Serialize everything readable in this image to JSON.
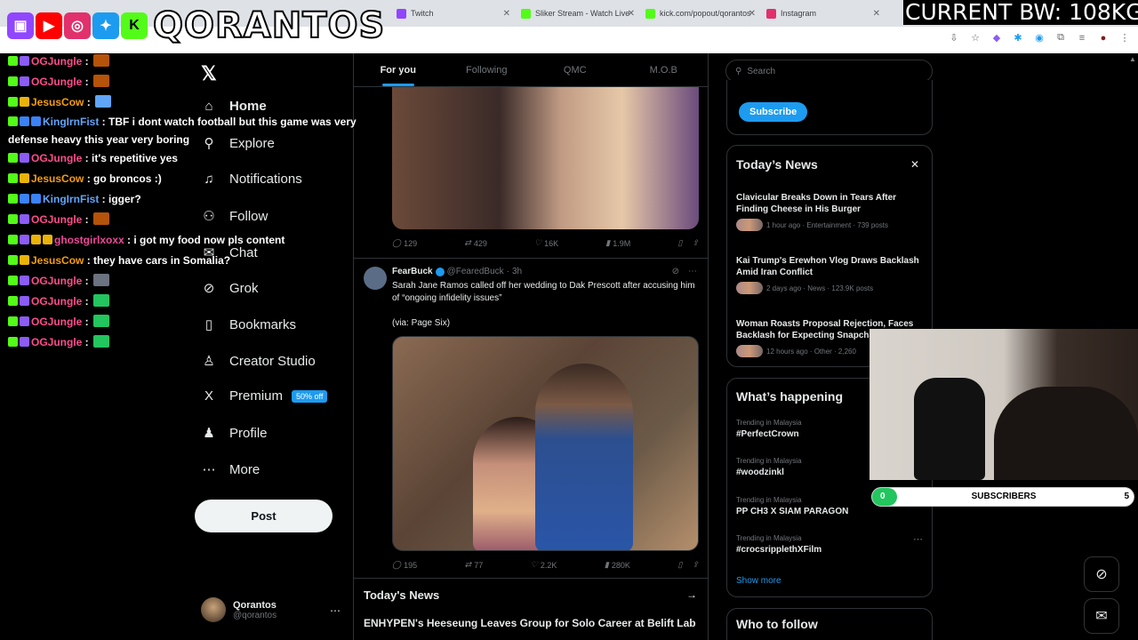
{
  "browser": {
    "tabs": [
      {
        "label": "Twitch",
        "color": "#9146ff"
      },
      {
        "label": "Sliker Stream - Watch Live",
        "color": "#53fc18"
      },
      {
        "label": "kick.com/popout/qorantos",
        "color": "#53fc18"
      },
      {
        "label": "Instagram",
        "color": "#e1306c"
      }
    ]
  },
  "overlay": {
    "logo_text": "QORANTOS",
    "bandwidth": "CURRENT BW: 108KG",
    "social_icons": [
      "twitch-icon",
      "youtube-icon",
      "instagram-icon",
      "twitter-icon",
      "kick-icon"
    ]
  },
  "chat": [
    {
      "user": "OGJungle",
      "color": "#ff4d8d",
      "text": "",
      "badges": [
        "kick",
        "purple"
      ],
      "emote": "#b45309"
    },
    {
      "user": "OGJungle",
      "color": "#ff4d8d",
      "text": "",
      "badges": [
        "kick",
        "purple"
      ],
      "emote": "#b45309"
    },
    {
      "user": "JesusCow",
      "color": "#f59e0b",
      "text": "",
      "badges": [
        "kick",
        "gold"
      ],
      "emote": "#60a5fa"
    },
    {
      "user": "KingIrnFist",
      "color": "#60a5fa",
      "text": "TBF i dont watch football but this game was very defense heavy this year very boring",
      "badges": [
        "kick",
        "blue",
        "blue"
      ],
      "emote": ""
    },
    {
      "user": "OGJungle",
      "color": "#ff4d8d",
      "text": "it's repetitive yes",
      "badges": [
        "kick",
        "purple"
      ],
      "emote": ""
    },
    {
      "user": "JesusCow",
      "color": "#f59e0b",
      "text": "go broncos :)",
      "badges": [
        "kick",
        "gold"
      ],
      "emote": ""
    },
    {
      "user": "KingIrnFist",
      "color": "#60a5fa",
      "text": "igger?",
      "badges": [
        "kick",
        "blue",
        "blue"
      ],
      "emote": ""
    },
    {
      "user": "OGJungle",
      "color": "#ff4d8d",
      "text": "",
      "badges": [
        "kick",
        "purple"
      ],
      "emote": "#b45309"
    },
    {
      "user": "ghostgirlxoxx",
      "color": "#ec4899",
      "text": "i got my food now pls content",
      "badges": [
        "kick",
        "purple",
        "gold",
        "gold"
      ],
      "emote": ""
    },
    {
      "user": "JesusCow",
      "color": "#f59e0b",
      "text": "they have cars in Somalia?",
      "badges": [
        "kick",
        "gold"
      ],
      "emote": ""
    },
    {
      "user": "OGJungle",
      "color": "#ff4d8d",
      "text": "",
      "badges": [
        "kick",
        "purple"
      ],
      "emote": "#6b7280"
    },
    {
      "user": "OGJungle",
      "color": "#ff4d8d",
      "text": "",
      "badges": [
        "kick",
        "purple"
      ],
      "emote": "#22c55e"
    },
    {
      "user": "OGJungle",
      "color": "#ff4d8d",
      "text": "",
      "badges": [
        "kick",
        "purple"
      ],
      "emote": "#22c55e"
    },
    {
      "user": "OGJungle",
      "color": "#ff4d8d",
      "text": "",
      "badges": [
        "kick",
        "purple"
      ],
      "emote": "#22c55e"
    }
  ],
  "sidebar": {
    "items": [
      {
        "label": "Home",
        "icon": "⌂"
      },
      {
        "label": "Explore",
        "icon": "⚲"
      },
      {
        "label": "Notifications",
        "icon": "♫"
      },
      {
        "label": "Follow",
        "icon": "⚇"
      },
      {
        "label": "Chat",
        "icon": "✉"
      },
      {
        "label": "Grok",
        "icon": "⊘"
      },
      {
        "label": "Bookmarks",
        "icon": "▯"
      },
      {
        "label": "Creator Studio",
        "icon": "♙"
      },
      {
        "label": "Premium",
        "icon": "X"
      },
      {
        "label": "Profile",
        "icon": "♟"
      },
      {
        "label": "More",
        "icon": "⋯"
      }
    ],
    "premium_badge": "50% off",
    "post_label": "Post",
    "user": {
      "name": "Qorantos",
      "handle": "@qorantos"
    }
  },
  "feed": {
    "tabs": [
      "For you",
      "Following",
      "QMC",
      "M.O.B"
    ],
    "tweet1_stats": {
      "replies": "129",
      "reposts": "429",
      "likes": "16K",
      "views": "1.9M"
    },
    "tweet2": {
      "name": "FearBuck",
      "handle": "@FearedBuck",
      "time": "3h",
      "text": "Sarah Jane Ramos called off her wedding to Dak Prescott after accusing him of “ongoing infidelity issues”",
      "via": "(via: Page Six)",
      "stats": {
        "replies": "195",
        "reposts": "77",
        "likes": "2.2K",
        "views": "280K"
      }
    },
    "news_header": "Today's News",
    "news_title": "ENHYPEN's Heeseung Leaves Group for Solo Career at Belift Lab"
  },
  "right": {
    "search_placeholder": "Search",
    "subscribe_label": "Subscribe",
    "todays_news_title": "Today’s News",
    "news": [
      {
        "title": "Clavicular Breaks Down in Tears After Finding Cheese in His Burger",
        "meta": "1 hour ago · Entertainment · 739 posts"
      },
      {
        "title": "Kai Trump's Erewhon Vlog Draws Backlash Amid Iran Conflict",
        "meta": "2 days ago · News · 123.9K posts"
      },
      {
        "title": "Woman Roasts Proposal Rejection, Faces Backlash for Expecting Snapchat",
        "meta": "12 hours ago · Other · 2,260"
      }
    ],
    "happening_title": "What’s happening",
    "trends": [
      {
        "context": "Trending in Malaysia",
        "name": "#PerfectCrown"
      },
      {
        "context": "Trending in Malaysia",
        "name": "#woodzinkl"
      },
      {
        "context": "Trending in Malaysia",
        "name": "PP CH3 X SIAM PARAGON"
      },
      {
        "context": "Trending in Malaysia",
        "name": "#crocsripplethXFilm"
      }
    ],
    "show_more": "Show more",
    "who_to_follow": "Who to follow"
  },
  "subs": {
    "label": "SUBSCRIBERS",
    "current": "0",
    "goal": "5",
    "progress": 0.0
  }
}
